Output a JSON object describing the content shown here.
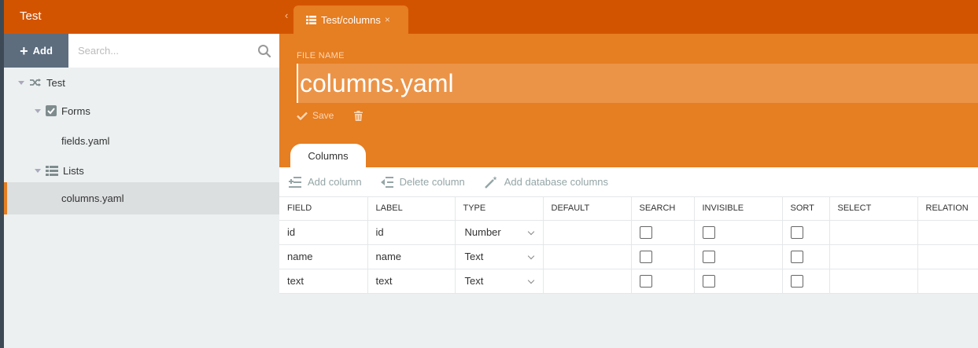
{
  "sidebar": {
    "title": "Test",
    "add_label": "Add",
    "search_placeholder": "Search...",
    "tree": [
      {
        "label": "Test",
        "icon": "shuffle-icon"
      },
      {
        "label": "Forms",
        "icon": "checkbox-icon"
      },
      {
        "label": "fields.yaml"
      },
      {
        "label": "Lists",
        "icon": "list-icon"
      },
      {
        "label": "columns.yaml",
        "selected": true
      }
    ]
  },
  "tabs": {
    "active_label": "Test/columns",
    "close_glyph": "×"
  },
  "form": {
    "file_name_label": "FILE NAME",
    "file_name_value": "columns.yaml",
    "save_label": "Save"
  },
  "section_tab": "Columns",
  "toolbar": {
    "add_column": "Add column",
    "delete_column": "Delete column",
    "add_db_columns": "Add database columns"
  },
  "table": {
    "headers": [
      "FIELD",
      "LABEL",
      "TYPE",
      "DEFAULT",
      "SEARCH",
      "INVISIBLE",
      "SORT",
      "SELECT",
      "RELATION"
    ],
    "rows": [
      {
        "field": "id",
        "label": "id",
        "type": "Number"
      },
      {
        "field": "name",
        "label": "name",
        "type": "Text"
      },
      {
        "field": "text",
        "label": "text",
        "type": "Text"
      }
    ]
  },
  "colors": {
    "header_orange": "#d35400",
    "form_orange": "#e67e22",
    "sidebar_bg": "#ecf0f1",
    "add_button": "#5d6d7e"
  }
}
